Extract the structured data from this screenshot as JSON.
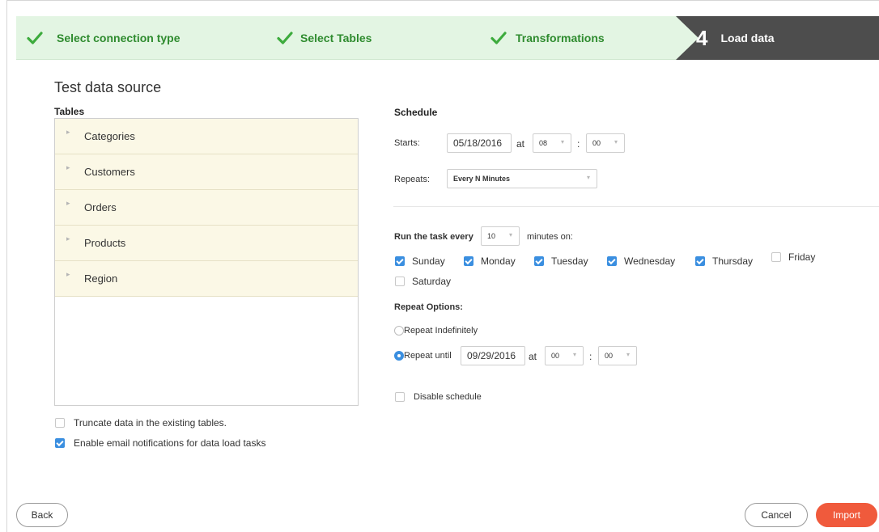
{
  "wizard": {
    "steps": [
      {
        "label": "Select connection type",
        "state": "done"
      },
      {
        "label": "Select Tables",
        "state": "done"
      },
      {
        "label": "Transformations",
        "state": "done"
      },
      {
        "label": "Load data",
        "number": "4",
        "state": "active"
      }
    ],
    "colors": {
      "done_bg": "#e3f5e3",
      "done_text": "#2e8b2e",
      "active_bg": "#4d4d4d"
    }
  },
  "left": {
    "title": "Test data source",
    "tables_label": "Tables",
    "tables": [
      "Categories",
      "Customers",
      "Orders",
      "Products",
      "Region"
    ],
    "options": [
      {
        "label": "Truncate data in the existing tables.",
        "checked": false
      },
      {
        "label": "Enable email notifications for data load tasks",
        "checked": true
      }
    ]
  },
  "schedule": {
    "heading": "Schedule",
    "starts_label": "Starts:",
    "start_date": "05/18/2016",
    "at_label": "at",
    "start_hour": "08",
    "colon": ":",
    "start_minute": "00",
    "repeats_label": "Repeats:",
    "repeats_value": "Every N Minutes",
    "run_prefix": "Run the task every",
    "run_interval": "10",
    "run_suffix": "minutes on:",
    "days": [
      {
        "label": "Sunday",
        "checked": true
      },
      {
        "label": "Monday",
        "checked": true
      },
      {
        "label": "Tuesday",
        "checked": true
      },
      {
        "label": "Wednesday",
        "checked": true
      },
      {
        "label": "Thursday",
        "checked": true
      },
      {
        "label": "Friday",
        "checked": false
      },
      {
        "label": "Saturday",
        "checked": false
      }
    ],
    "repeat_options_label": "Repeat Options:",
    "repeat_indefinitely": "Repeat Indefinitely",
    "repeat_until": "Repeat until",
    "until_date": "09/29/2016",
    "until_at": "at",
    "until_hour": "00",
    "until_minute": "00",
    "disable_label": "Disable schedule",
    "disable_checked": false,
    "accent": "#3b8fe0"
  },
  "footer": {
    "back": "Back",
    "cancel": "Cancel",
    "import": "Import",
    "import_color": "#f05a3c"
  }
}
